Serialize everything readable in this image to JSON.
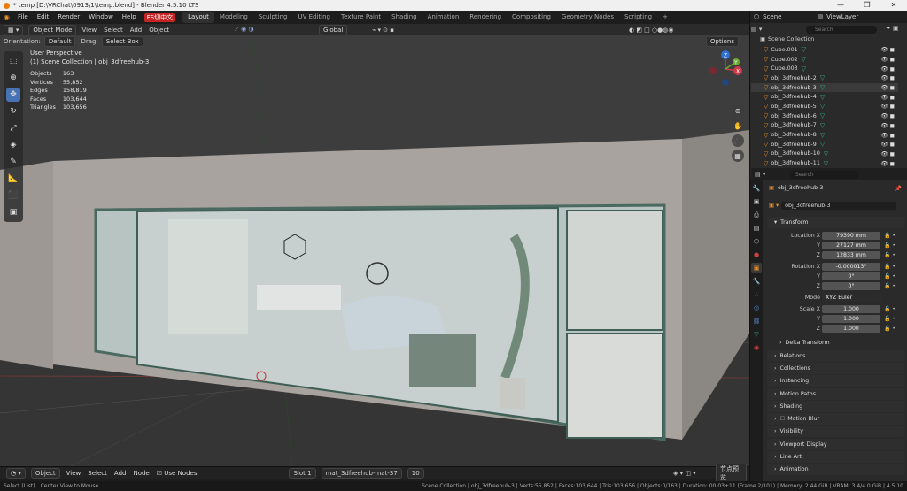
{
  "window": {
    "title": "* temp [D:\\VRChat\\0913\\1\\temp.blend] - Blender 4.5.10 LTS",
    "controls": [
      "—",
      "❐",
      "✕"
    ]
  },
  "menu": [
    "File",
    "Edit",
    "Render",
    "Window",
    "Help"
  ],
  "ime_badge": "FS切中文",
  "workspaces": [
    "Layout",
    "Modeling",
    "Sculpting",
    "UV Editing",
    "Texture Paint",
    "Shading",
    "Animation",
    "Rendering",
    "Compositing",
    "Geometry Nodes",
    "Scripting"
  ],
  "workspace_add": "+",
  "viewport": {
    "mode": "Object Mode",
    "menus": [
      "View",
      "Select",
      "Add",
      "Object"
    ],
    "transform_orientation": "Global",
    "orientation_label": "Orientation:",
    "orientation_value": "Default",
    "drag_label": "Drag:",
    "drag_value": "Select Box",
    "options": "Options",
    "overlay_title": "User Perspective",
    "overlay_collection": "(1) Scene Collection | obj_3dfreehub-3",
    "stats": [
      {
        "k": "Objects",
        "v": "163"
      },
      {
        "k": "Vertices",
        "v": "55,852"
      },
      {
        "k": "Edges",
        "v": "158,819"
      },
      {
        "k": "Faces",
        "v": "103,644"
      },
      {
        "k": "Triangles",
        "v": "103,656"
      }
    ],
    "gizmo": {
      "z": "Z",
      "y": "Y",
      "x": "X"
    }
  },
  "timeline": {
    "mode": "Object",
    "menus": [
      "View",
      "Select",
      "Add",
      "Node"
    ],
    "use_nodes": "Use Nodes",
    "slot": "Slot 1",
    "material": "mat_3dfreehub-mat-37",
    "users": "10",
    "right_label": "节点预览"
  },
  "statusbar": {
    "left": "Select (List)",
    "mid": "Center View to Mouse",
    "right": "Scene Collection | obj_3dfreehub-3 | Verts:55,852 | Faces:103,644 | Tris:103,656 | Objects:0/163 | Duration: 00:03+11 (Frame 2/101) | Memory: 2.44 GiB | VRAM: 3.4/4.0 GiB | 4.5.10"
  },
  "outliner": {
    "scene": "Scene",
    "view_layer": "ViewLayer",
    "search_placeholder": "Search",
    "root": "Scene Collection",
    "items": [
      "Cube.001",
      "Cube.002",
      "Cube.003",
      "obj_3dfreehub-2",
      "obj_3dfreehub-3",
      "obj_3dfreehub-4",
      "obj_3dfreehub-5",
      "obj_3dfreehub-6",
      "obj_3dfreehub-7",
      "obj_3dfreehub-8",
      "obj_3dfreehub-9",
      "obj_3dfreehub-10",
      "obj_3dfreehub-11"
    ]
  },
  "properties": {
    "search_placeholder": "Search",
    "object_name": "obj_3dfreehub-3",
    "datablock": "obj_3dfreehub-3",
    "transform": "Transform",
    "location": {
      "label": "Location X",
      "x": "79390 mm",
      "y": "27127 mm",
      "z": "12833 mm"
    },
    "rotation": {
      "label": "Rotation X",
      "x": "-0.000013°",
      "y": "0°",
      "z": "0°"
    },
    "mode": {
      "label": "Mode",
      "value": "XYZ Euler"
    },
    "scale": {
      "label": "Scale X",
      "x": "1.000",
      "y": "1.000",
      "z": "1.000"
    },
    "axes": {
      "y": "Y",
      "z": "Z"
    },
    "sections": [
      "Delta Transform",
      "Relations",
      "Collections",
      "Instancing",
      "Motion Paths",
      "Shading",
      "Motion Blur",
      "Visibility",
      "Viewport Display",
      "Line Art",
      "Animation"
    ]
  },
  "colors": {
    "accent": "#4772b3",
    "object_orange": "#e8902a",
    "mesh_green": "#36b08a"
  }
}
